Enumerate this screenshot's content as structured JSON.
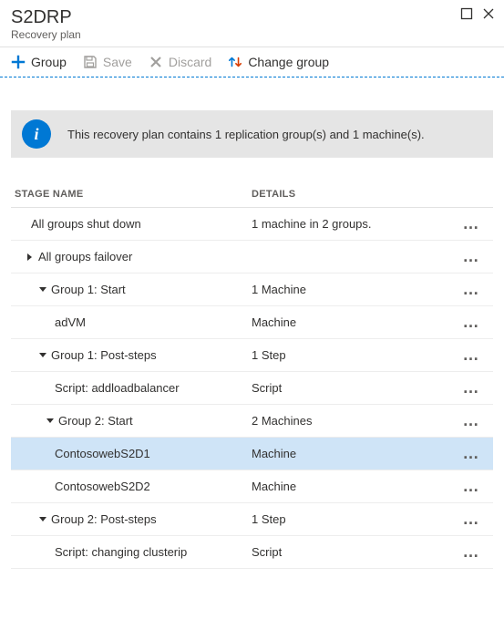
{
  "header": {
    "title": "S2DRP",
    "subtitle": "Recovery plan"
  },
  "toolbar": {
    "group": "Group",
    "save": "Save",
    "discard": "Discard",
    "change_group": "Change group"
  },
  "banner": {
    "text": "This recovery plan contains 1 replication group(s) and 1 machine(s)."
  },
  "columns": {
    "stage": "STAGE NAME",
    "details": "DETAILS"
  },
  "rows": [
    {
      "stage": "All groups shut down",
      "details": "1 machine in 2 groups.",
      "caret": "none",
      "indent": "indent-0",
      "selected": false
    },
    {
      "stage": "All groups failover",
      "details": "",
      "caret": "right",
      "indent": "indent-1",
      "selected": false
    },
    {
      "stage": "Group 1: Start",
      "details": "1 Machine",
      "caret": "down",
      "indent": "indent-2b",
      "selected": false
    },
    {
      "stage": "adVM",
      "details": "Machine",
      "caret": "none",
      "indent": "indent-3",
      "selected": false
    },
    {
      "stage": "Group 1: Post-steps",
      "details": "1 Step",
      "caret": "down",
      "indent": "indent-2b",
      "selected": false
    },
    {
      "stage": "Script: addloadbalancer",
      "details": "Script",
      "caret": "none",
      "indent": "indent-3",
      "selected": false
    },
    {
      "stage": "Group 2: Start",
      "details": "2 Machines",
      "caret": "down",
      "indent": "indent-2",
      "selected": false
    },
    {
      "stage": "ContosowebS2D1",
      "details": "Machine",
      "caret": "none",
      "indent": "indent-3",
      "selected": true
    },
    {
      "stage": "ContosowebS2D2",
      "details": "Machine",
      "caret": "none",
      "indent": "indent-3",
      "selected": false
    },
    {
      "stage": "Group 2: Post-steps",
      "details": "1 Step",
      "caret": "down",
      "indent": "indent-2b",
      "selected": false
    },
    {
      "stage": "Script: changing clusterip",
      "details": "Script",
      "caret": "none",
      "indent": "indent-3",
      "selected": false
    }
  ]
}
